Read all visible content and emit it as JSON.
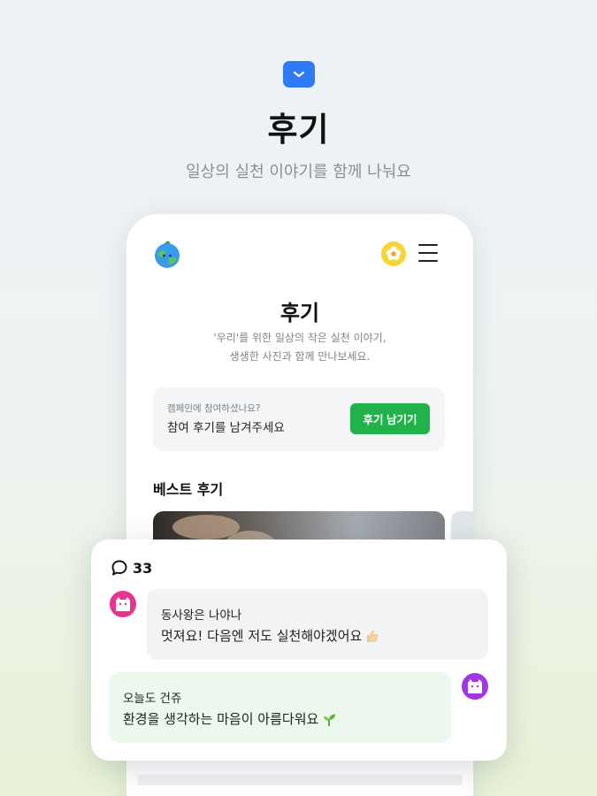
{
  "hero": {
    "title": "후기",
    "subtitle": "일상의 실천 이야기를 함께 나눠요",
    "badge_icon": "chevron-down-icon"
  },
  "app": {
    "logo_icon": "earth-logo-icon",
    "profile_icon": "flower-avatar-icon",
    "menu_icon": "hamburger-menu-icon",
    "page_title": "후기",
    "description_line1": "'우리'를 위한 일상의 작은 실천 이야기,",
    "description_line2": "생생한 사진과 함께 만나보세요.",
    "cta": {
      "question": "캠페인에 참여하셨나요?",
      "prompt": "참여 후기를 남겨주세요",
      "button_label": "후기 남기기"
    },
    "best_section_title": "베스트 후기"
  },
  "comments": {
    "icon": "speech-bubble-icon",
    "count": "33",
    "items": [
      {
        "name": "동사왕은 나야나",
        "text": "멋져요! 다음엔 저도 실천해야겠어요",
        "emoji_icon": "thumbs-up-icon",
        "avatar_icon": "pink-cat-avatar-icon"
      },
      {
        "name": "오늘도 건쥬",
        "text": "환경을 생각하는 마음이 아름다워요",
        "emoji_icon": "sprout-icon",
        "avatar_icon": "purple-cat-avatar-icon"
      }
    ]
  },
  "colors": {
    "accent_blue": "#2f7af5",
    "accent_green": "#22b24c",
    "avatar_pink": "#e8348f",
    "avatar_purple": "#a437e3"
  }
}
